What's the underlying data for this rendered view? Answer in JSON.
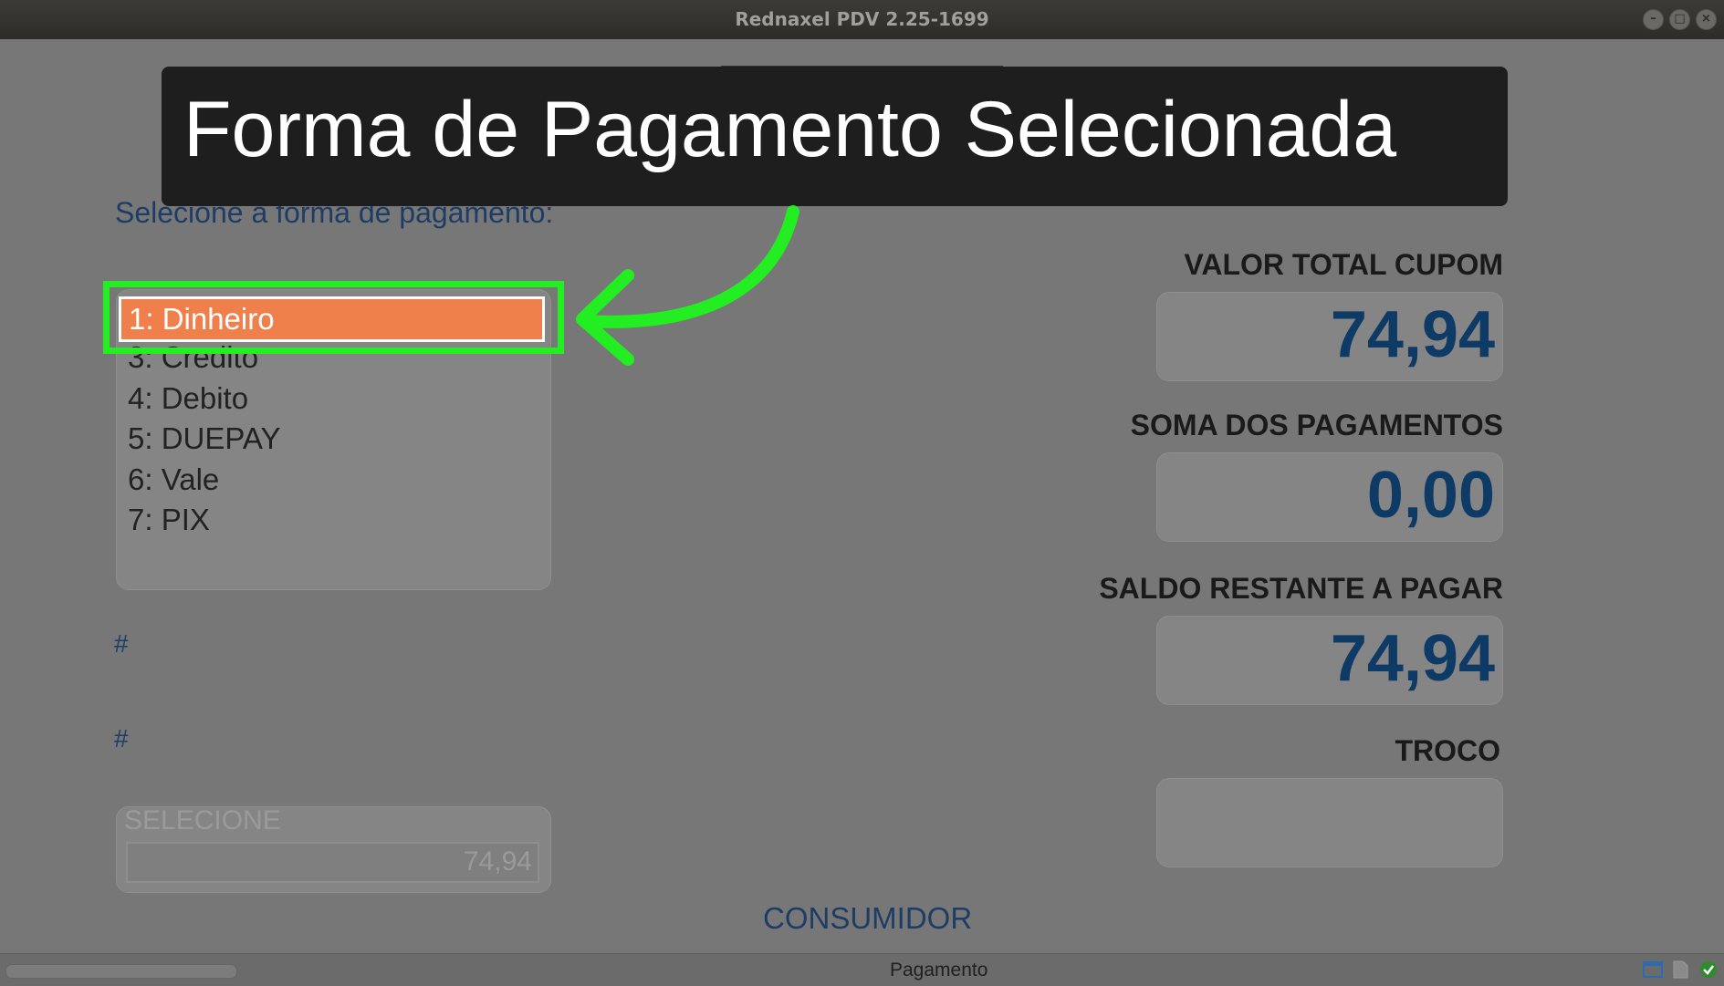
{
  "window": {
    "title": "Rednaxel PDV 2.25-1699",
    "buttons": [
      "–",
      "□",
      "×"
    ]
  },
  "annotation": {
    "banner_text": "Forma de Pagamento Selecionada",
    "highlight_color": "#22ee22"
  },
  "payment": {
    "prompt": "Selecione a forma de pagamento:",
    "selected_item": "1: Dinheiro",
    "items": [
      {
        "label": "3: Credito"
      },
      {
        "label": "4: Debito"
      },
      {
        "label": "5: DUEPAY"
      },
      {
        "label": "6: Vale"
      },
      {
        "label": "7: PIX"
      }
    ],
    "hash1": "#",
    "hash2": "#",
    "select_label": "SELECIONE",
    "select_value": "74,94",
    "consumer": "CONSUMIDOR"
  },
  "totals": {
    "valor_total_label": "VALOR TOTAL CUPOM",
    "valor_total_value": "74,94",
    "soma_label": "SOMA DOS PAGAMENTOS",
    "soma_value": "0,00",
    "saldo_label": "SALDO RESTANTE A PAGAR",
    "saldo_value": "74,94",
    "troco_label": "TROCO",
    "troco_value": ""
  },
  "statusbar": {
    "text": "Pagamento"
  },
  "colors": {
    "selection": "#f0804b",
    "value_blue": "#0e3a66",
    "label_blue": "#1e3d66"
  }
}
